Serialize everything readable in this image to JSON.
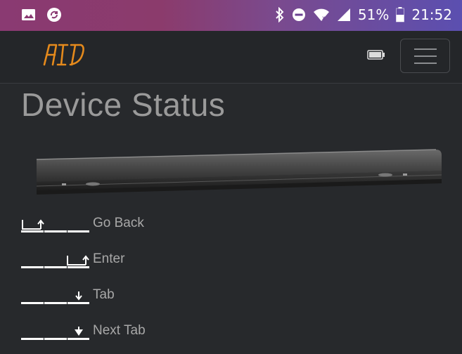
{
  "status_bar": {
    "battery_percent": "51%",
    "time": "21:52",
    "icons": [
      "image-icon",
      "sync-icon",
      "bluetooth-icon",
      "do-not-disturb-icon",
      "wifi-icon",
      "cell-signal-icon",
      "battery-icon"
    ]
  },
  "navbar": {
    "logo_text": "AID",
    "logo_color": "#e58a1c",
    "device_battery_icon": "battery-icon",
    "menu_icon": "hamburger-icon"
  },
  "page": {
    "title": "Device Status"
  },
  "key_legend": [
    {
      "label": "Go Back",
      "icon": "go-back-key-icon"
    },
    {
      "label": "Enter",
      "icon": "enter-key-icon"
    },
    {
      "label": "Tab",
      "icon": "tab-key-icon"
    },
    {
      "label": "Next Tab",
      "icon": "next-tab-key-icon"
    }
  ],
  "colors": {
    "background": "#27292c",
    "title": "#9a9a9a",
    "label": "#a8a8a8"
  }
}
